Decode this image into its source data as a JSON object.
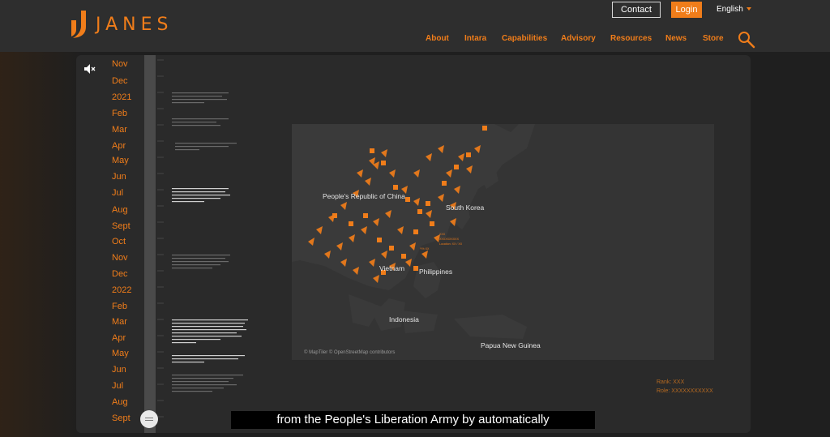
{
  "brand": {
    "name": "JANES",
    "color": "#f07d1a"
  },
  "header": {
    "contact_label": "Contact",
    "login_label": "Login",
    "language_label": "English"
  },
  "nav": [
    {
      "label": "About"
    },
    {
      "label": "Intara"
    },
    {
      "label": "Capabilities"
    },
    {
      "label": "Advisory"
    },
    {
      "label": "Resources"
    },
    {
      "label": "News"
    },
    {
      "label": "Store"
    }
  ],
  "icons": {
    "search": "search-icon",
    "mute": "speaker-muted-icon",
    "scrubber": "scrubber-knob-icon"
  },
  "timeline": {
    "months": [
      "Nov",
      "Dec",
      "2021",
      "Feb",
      "Mar",
      "Apr",
      "May",
      "Jun",
      "Jul",
      "Aug",
      "Sept",
      "Oct",
      "Nov",
      "Dec",
      "2022",
      "Feb",
      "Mar",
      "Apr",
      "May",
      "Jun",
      "Jul",
      "Aug",
      "Sept"
    ]
  },
  "map": {
    "labels": {
      "china": "People's Republic of China",
      "south_korea": "South Korea",
      "vietnam": "Vietnam",
      "philippines": "Philippines",
      "indonesia": "Indonesia",
      "png": "Papua New Guinea"
    },
    "credit": "© MapTiler © OpenStreetMap contributors",
    "tags": [
      "XXX",
      "XXXXXXXXXX",
      "Location: XX / XX",
      "Y% XX"
    ]
  },
  "person": {
    "rank": "Rank: XXX",
    "role": "Role: XXXXXXXXXXX"
  },
  "subtitle": "from the People's Liberation Army by automatically"
}
